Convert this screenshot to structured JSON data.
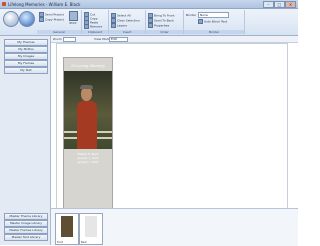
{
  "window": {
    "title": "Lifelong Memories - William E. Black",
    "minimize": "–",
    "maximize": "□",
    "close": "✕"
  },
  "ribbon": {
    "groups": [
      "General",
      "Clipboard",
      "Insert",
      "Order",
      "Border"
    ],
    "items": {
      "send_project": "Send Project",
      "copy_project": "Copy Project",
      "print": "Print",
      "cut": "Cut",
      "copy": "Copy",
      "paste": "Paste",
      "remove": "Remove",
      "select_all": "Select All",
      "clear_selection": "Clear Selection",
      "layers": "Layers",
      "bring_to_front": "Bring To Front",
      "send_to_back": "Send To Back",
      "properties": "Properties",
      "border_label": "Border",
      "border_value": "None",
      "auto_block_text": "Auto Block Text"
    }
  },
  "sidebar": {
    "top_items": [
      "My Themes",
      "My Mottos",
      "My Images",
      "My Frames",
      "My Text"
    ],
    "bottom_items": [
      "Master Theme Library",
      "Master Image Library",
      "Master Frames Library",
      "Master Text Library"
    ]
  },
  "toolbar": {
    "zoom_label": "Zoom",
    "view_mode_label": "View Mode",
    "view_mode_value": "Edit"
  },
  "document": {
    "title": "In Loving Memory",
    "name_line": "William E. Black",
    "date_line1": "January 1, 1920",
    "date_line2": "January 1, 2006"
  },
  "tray": {
    "thumbs": [
      "Front",
      "Back"
    ]
  }
}
